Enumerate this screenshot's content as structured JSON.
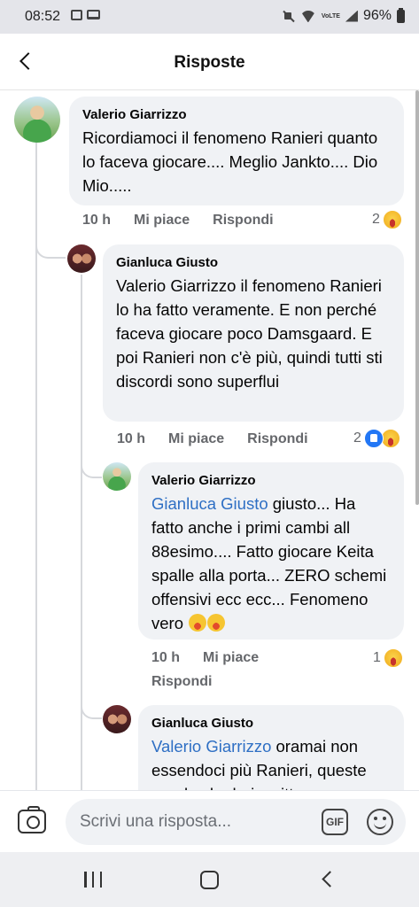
{
  "status_bar": {
    "time": "08:52",
    "volte": "VoLTE",
    "battery": "96%"
  },
  "header": {
    "title": "Risposte"
  },
  "comments": [
    {
      "author": "Valerio Giarrizzo",
      "text": "Ricordiamoci il fenomeno Ranieri quanto lo faceva giocare.... Meglio Jankto.... Dio Mio.....",
      "time": "10 h",
      "like": "Mi piace",
      "reply": "Rispondi",
      "reactions": "2"
    },
    {
      "author": "Gianluca Giusto",
      "text": "Valerio Giarrizzo il fenomeno Ranieri lo ha fatto veramente.  E non perché faceva giocare poco Damsgaard.  E poi Ranieri non c'è più,  quindi tutti sti discordi sono superflui",
      "time": "10 h",
      "like": "Mi piace",
      "reply": "Rispondi",
      "reactions": "2"
    },
    {
      "author": "Valerio Giarrizzo",
      "mention": "Gianluca Giusto",
      "text": " giusto... Ha fatto anche i primi cambi all 88esimo.... Fatto giocare Keita spalle alla porta... ZERO schemi offensivi ecc ecc... Fenomeno vero ",
      "time": "10 h",
      "like": "Mi piace",
      "reply": "Rispondi",
      "reactions": "1"
    },
    {
      "author": "Gianluca Giusto",
      "mention": "Valerio Giarrizzo",
      "text": " oramai non essendoci più Ranieri, queste parole che hai scritto"
    }
  ],
  "composer": {
    "placeholder": "Scrivi una risposta...",
    "gif_label": "GIF"
  }
}
